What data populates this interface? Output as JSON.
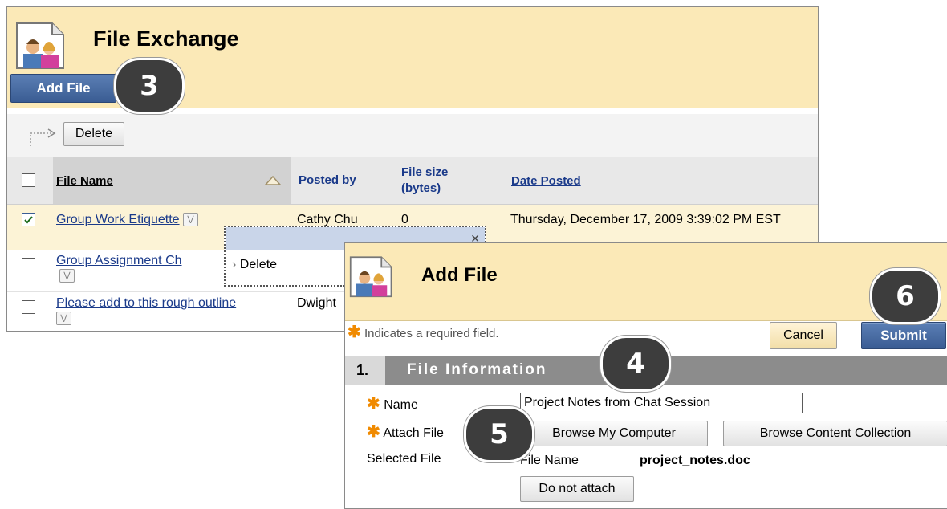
{
  "file_exchange": {
    "title": "File Exchange",
    "add_file_label": "Add File",
    "delete_label": "Delete",
    "columns": [
      "File Name",
      "Posted by",
      "File size (bytes)",
      "Date Posted"
    ],
    "rows": [
      {
        "name": "Group Work Etiquette",
        "posted_by": "Cathy Chu",
        "size": "0",
        "date": "Thursday, December 17, 2009 3:39:02 PM EST",
        "checked": true
      },
      {
        "name": "Group Assignment Ch",
        "posted_by": "",
        "size": "",
        "date": "",
        "checked": false
      },
      {
        "name": "Please add to this rough outline",
        "posted_by": "Dwight",
        "size": "",
        "date": "",
        "checked": false
      }
    ]
  },
  "context_menu": {
    "items": [
      "Delete"
    ]
  },
  "add_file": {
    "title": "Add File",
    "required_note": "Indicates a required field.",
    "cancel_label": "Cancel",
    "submit_label": "Submit",
    "section_number": "1.",
    "section_title": "File Information",
    "name_label": "Name",
    "name_value": "Project Notes from Chat Session",
    "attach_label": "Attach File",
    "browse_computer_label": "Browse My Computer",
    "browse_collection_label": "Browse Content Collection",
    "selected_file_label": "Selected File",
    "file_name_label": "File Name",
    "file_name_value": "project_notes.doc",
    "do_not_attach_label": "Do not attach"
  },
  "steps": [
    "3",
    "4",
    "5",
    "6"
  ],
  "colors": {
    "header_bg": "#fbe9b7",
    "button_blue": "#3a5c93",
    "link": "#1a3a8a",
    "required_star": "#f08a00",
    "badge": "#3d3d3d"
  }
}
